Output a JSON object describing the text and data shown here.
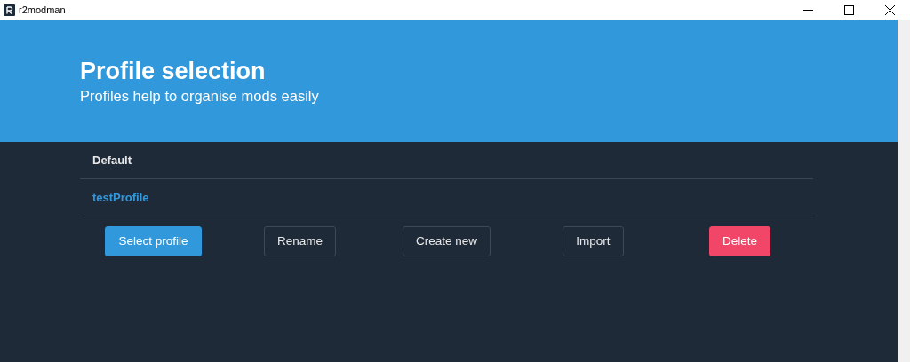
{
  "window": {
    "title": "r2modman"
  },
  "hero": {
    "title": "Profile selection",
    "subtitle": "Profiles help to organise mods easily"
  },
  "profiles": [
    {
      "name": "Default",
      "selected": false
    },
    {
      "name": "testProfile",
      "selected": true
    }
  ],
  "buttons": [
    {
      "label": "Select profile",
      "kind": "primary"
    },
    {
      "label": "Rename",
      "kind": "outline"
    },
    {
      "label": "Create new",
      "kind": "outline"
    },
    {
      "label": "Import",
      "kind": "outline"
    },
    {
      "label": "Delete",
      "kind": "danger"
    }
  ]
}
